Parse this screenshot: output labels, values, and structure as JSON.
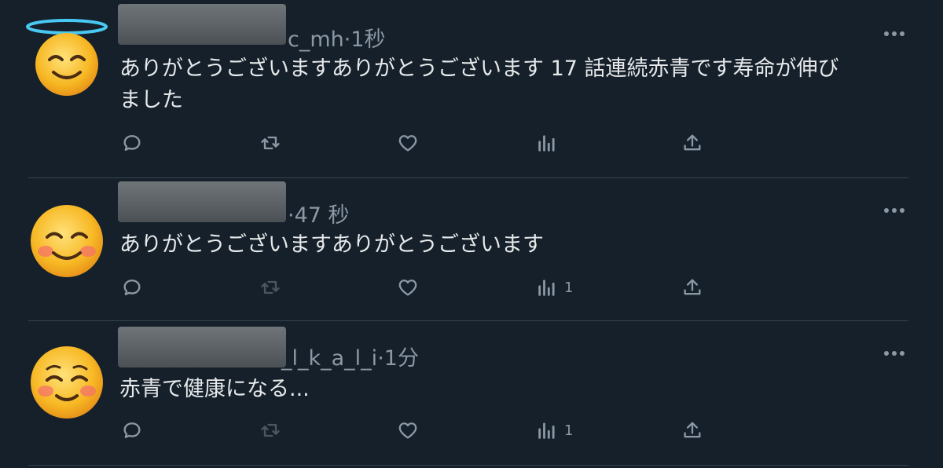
{
  "tweets": [
    {
      "avatar_emoji": "smiling-face-with-halo",
      "handle_suffix": "c_mh",
      "time": "1秒",
      "text_lines": [
        "ありがとうございますありがとうございます 17 話連続赤青です寿命が伸び",
        "ました"
      ],
      "views": ""
    },
    {
      "avatar_emoji": "smiling-face-with-smiling-eyes",
      "handle_suffix": "",
      "time": "47 秒",
      "text_lines": [
        "ありがとうございますありがとうございます"
      ],
      "views": "1"
    },
    {
      "avatar_emoji": "smiling-face",
      "handle_suffix": "_l_k_a_l_i",
      "time": "1分",
      "text_lines": [
        "赤青で健康になる..."
      ],
      "views": "1"
    }
  ],
  "colors": {
    "background": "#15202b",
    "text": "#e7e9ea",
    "muted": "#8b98a5",
    "divider": "#38444d"
  },
  "icons": [
    "reply-icon",
    "retweet-icon",
    "like-icon",
    "views-icon",
    "share-icon",
    "more-icon"
  ]
}
